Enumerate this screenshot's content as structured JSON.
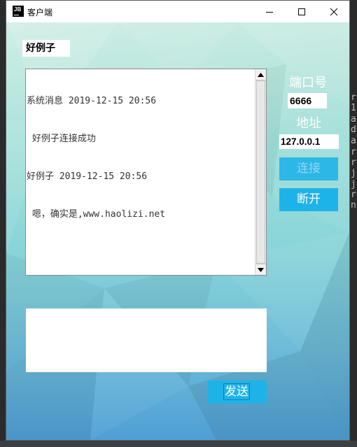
{
  "window": {
    "title": "客户端",
    "app_icon_text": "JB"
  },
  "name_label": "好例子",
  "chat": {
    "lines": [
      "系统消息 2019-12-15 20:56",
      " 好例子连接成功",
      "好例子 2019-12-15 20:56",
      " 嗯，确实是,www.haolizi.net"
    ]
  },
  "connection": {
    "port_label": "端口号",
    "port_value": "6666",
    "address_label": "地址",
    "address_value": "127.0.0.1",
    "connect_label": "连接",
    "disconnect_label": "断开"
  },
  "message_input": {
    "value": ""
  },
  "send_label": "发送",
  "background_ide_text": [
    "r",
    "1",
    "a",
    "d",
    "a",
    "r",
    "r",
    "j",
    "j",
    "r",
    "n"
  ],
  "colors": {
    "accent": "#1eb3e8",
    "gradient_top": "#bfe8dc",
    "gradient_bottom": "#4f9fd6"
  }
}
